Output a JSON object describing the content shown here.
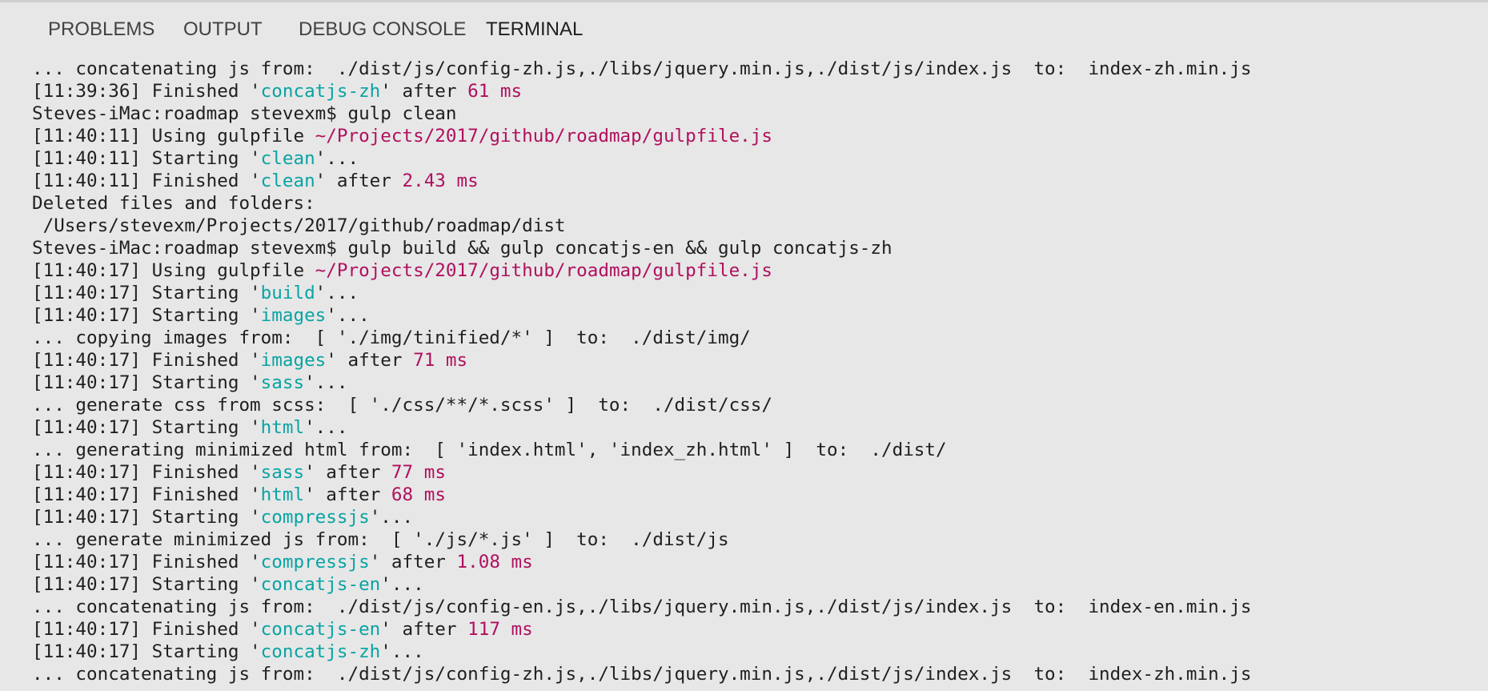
{
  "tabs": [
    {
      "label": "PROBLEMS"
    },
    {
      "label": "OUTPUT"
    },
    {
      "label": "DEBUG CONSOLE"
    },
    {
      "label": "TERMINAL",
      "active": true
    }
  ],
  "colors": {
    "background": "#e7e7e7",
    "text": "#1f1f1f",
    "task_name": "#0aa3a3",
    "timing_and_path": "#b0105e"
  },
  "terminal": {
    "lines": [
      [
        {
          "t": "... concatenating js from:  ./dist/js/config-zh.js,./libs/jquery.min.js,./dist/js/index.js  to:  index-zh.min.js",
          "c": ""
        }
      ],
      [
        {
          "t": "[11:39:36] Finished '",
          "c": ""
        },
        {
          "t": "concatjs-zh",
          "c": "cyan"
        },
        {
          "t": "' after ",
          "c": ""
        },
        {
          "t": "61 ms",
          "c": "magenta"
        }
      ],
      [
        {
          "t": "Steves-iMac:roadmap stevexm$ gulp clean",
          "c": ""
        }
      ],
      [
        {
          "t": "[11:40:11] Using gulpfile ",
          "c": ""
        },
        {
          "t": "~/Projects/2017/github/roadmap/gulpfile.js",
          "c": "magenta"
        }
      ],
      [
        {
          "t": "[11:40:11] Starting '",
          "c": ""
        },
        {
          "t": "clean",
          "c": "cyan"
        },
        {
          "t": "'...",
          "c": ""
        }
      ],
      [
        {
          "t": "[11:40:11] Finished '",
          "c": ""
        },
        {
          "t": "clean",
          "c": "cyan"
        },
        {
          "t": "' after ",
          "c": ""
        },
        {
          "t": "2.43 ms",
          "c": "magenta"
        }
      ],
      [
        {
          "t": "Deleted files and folders:",
          "c": ""
        }
      ],
      [
        {
          "t": " /Users/stevexm/Projects/2017/github/roadmap/dist",
          "c": ""
        }
      ],
      [
        {
          "t": "Steves-iMac:roadmap stevexm$ gulp build && gulp concatjs-en && gulp concatjs-zh",
          "c": ""
        }
      ],
      [
        {
          "t": "[11:40:17] Using gulpfile ",
          "c": ""
        },
        {
          "t": "~/Projects/2017/github/roadmap/gulpfile.js",
          "c": "magenta"
        }
      ],
      [
        {
          "t": "[11:40:17] Starting '",
          "c": ""
        },
        {
          "t": "build",
          "c": "cyan"
        },
        {
          "t": "'...",
          "c": ""
        }
      ],
      [
        {
          "t": "[11:40:17] Starting '",
          "c": ""
        },
        {
          "t": "images",
          "c": "cyan"
        },
        {
          "t": "'...",
          "c": ""
        }
      ],
      [
        {
          "t": "... copying images from:  [ './img/tinified/*' ]  to:  ./dist/img/",
          "c": ""
        }
      ],
      [
        {
          "t": "[11:40:17] Finished '",
          "c": ""
        },
        {
          "t": "images",
          "c": "cyan"
        },
        {
          "t": "' after ",
          "c": ""
        },
        {
          "t": "71 ms",
          "c": "magenta"
        }
      ],
      [
        {
          "t": "[11:40:17] Starting '",
          "c": ""
        },
        {
          "t": "sass",
          "c": "cyan"
        },
        {
          "t": "'...",
          "c": ""
        }
      ],
      [
        {
          "t": "... generate css from scss:  [ './css/**/*.scss' ]  to:  ./dist/css/",
          "c": ""
        }
      ],
      [
        {
          "t": "[11:40:17] Starting '",
          "c": ""
        },
        {
          "t": "html",
          "c": "cyan"
        },
        {
          "t": "'...",
          "c": ""
        }
      ],
      [
        {
          "t": "... generating minimized html from:  [ 'index.html', 'index_zh.html' ]  to:  ./dist/",
          "c": ""
        }
      ],
      [
        {
          "t": "[11:40:17] Finished '",
          "c": ""
        },
        {
          "t": "sass",
          "c": "cyan"
        },
        {
          "t": "' after ",
          "c": ""
        },
        {
          "t": "77 ms",
          "c": "magenta"
        }
      ],
      [
        {
          "t": "[11:40:17] Finished '",
          "c": ""
        },
        {
          "t": "html",
          "c": "cyan"
        },
        {
          "t": "' after ",
          "c": ""
        },
        {
          "t": "68 ms",
          "c": "magenta"
        }
      ],
      [
        {
          "t": "[11:40:17] Starting '",
          "c": ""
        },
        {
          "t": "compressjs",
          "c": "cyan"
        },
        {
          "t": "'...",
          "c": ""
        }
      ],
      [
        {
          "t": "... generate minimized js from:  [ './js/*.js' ]  to:  ./dist/js",
          "c": ""
        }
      ],
      [
        {
          "t": "[11:40:17] Finished '",
          "c": ""
        },
        {
          "t": "compressjs",
          "c": "cyan"
        },
        {
          "t": "' after ",
          "c": ""
        },
        {
          "t": "1.08 ms",
          "c": "magenta"
        }
      ],
      [
        {
          "t": "[11:40:17] Starting '",
          "c": ""
        },
        {
          "t": "concatjs-en",
          "c": "cyan"
        },
        {
          "t": "'...",
          "c": ""
        }
      ],
      [
        {
          "t": "... concatenating js from:  ./dist/js/config-en.js,./libs/jquery.min.js,./dist/js/index.js  to:  index-en.min.js",
          "c": ""
        }
      ],
      [
        {
          "t": "[11:40:17] Finished '",
          "c": ""
        },
        {
          "t": "concatjs-en",
          "c": "cyan"
        },
        {
          "t": "' after ",
          "c": ""
        },
        {
          "t": "117 ms",
          "c": "magenta"
        }
      ],
      [
        {
          "t": "[11:40:17] Starting '",
          "c": ""
        },
        {
          "t": "concatjs-zh",
          "c": "cyan"
        },
        {
          "t": "'...",
          "c": ""
        }
      ],
      [
        {
          "t": "... concatenating js from:  ./dist/js/config-zh.js,./libs/jquery.min.js,./dist/js/index.js  to:  index-zh.min.js",
          "c": ""
        }
      ]
    ]
  }
}
